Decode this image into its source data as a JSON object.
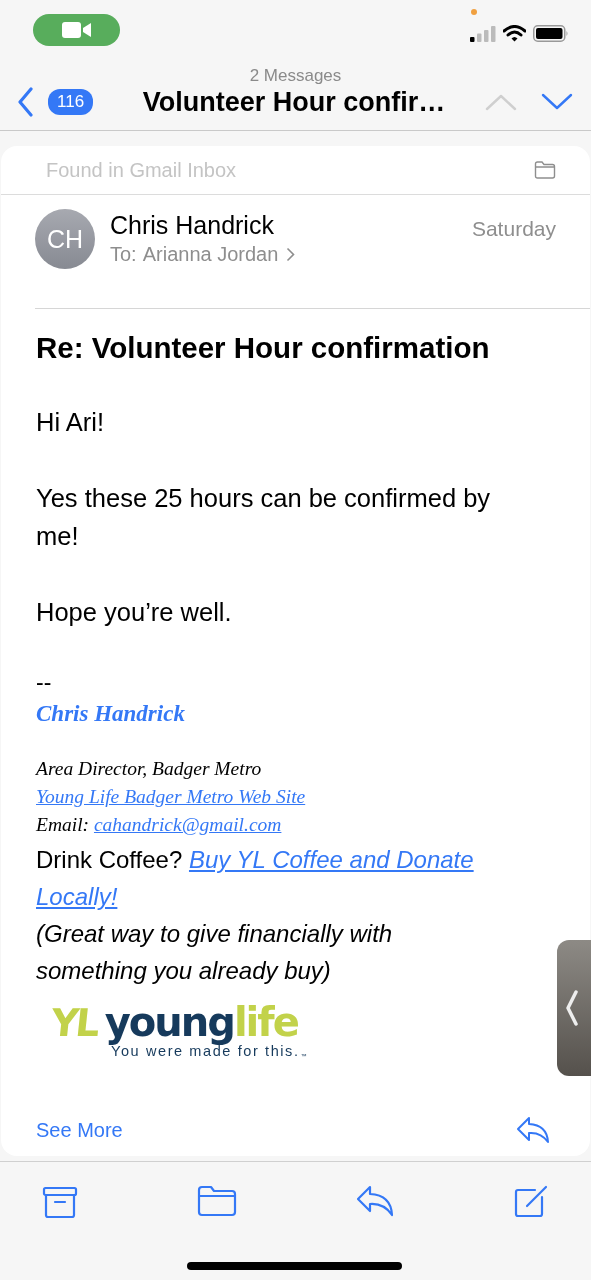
{
  "nav": {
    "back_count": "116",
    "count_label": "2 Messages",
    "title": "Volunteer Hour confir…",
    "previous_enabled": false,
    "next_enabled": true
  },
  "message": {
    "mailbox": "Found in Gmail Inbox",
    "initials": "CH",
    "sender": "Chris Handrick",
    "to_label": "To:",
    "recipient": "Arianna Jordan",
    "date": "Saturday",
    "subject": "Re: Volunteer Hour confirmation",
    "body": [
      "Hi Ari!",
      "Yes these 25 hours can be confirmed by me!",
      "Hope you’re well."
    ],
    "signature": {
      "separator": "--",
      "name": "Chris Handrick",
      "role": "Area Director, Badger Metro",
      "website": "Young Life Badger Metro Web Site",
      "email_label": "Email:",
      "email": "cahandrick@gmail.com",
      "coffee_prompt": "Drink Coffee?",
      "coffee_link": "Buy YL Coffee and Donate Locally!",
      "note": "(Great way to give financially with something you already buy)"
    },
    "logo": {
      "mark": "YL",
      "word_first": "young",
      "word_second": "life",
      "tagline": "You were made for this.",
      "tagline_mark": "™"
    },
    "see_more": "See More"
  }
}
